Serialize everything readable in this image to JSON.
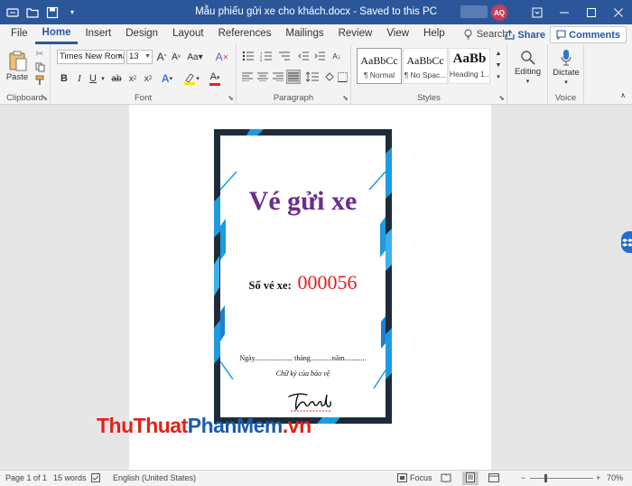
{
  "titlebar": {
    "title": "Mẫu phiếu gửi xe cho khách.docx  -  Saved to this PC",
    "avatar_initials": "AQ"
  },
  "tabs": [
    "File",
    "Home",
    "Insert",
    "Design",
    "Layout",
    "References",
    "Mailings",
    "Review",
    "View",
    "Help"
  ],
  "active_tab": "Home",
  "search_label": "Search",
  "share_label": "Share",
  "comments_label": "Comments",
  "ribbon": {
    "clipboard": {
      "label": "Clipboard",
      "paste": "Paste"
    },
    "font": {
      "label": "Font",
      "font_name": "Times New Roman",
      "font_size": "13"
    },
    "paragraph": {
      "label": "Paragraph"
    },
    "styles": {
      "label": "Styles",
      "items": [
        {
          "preview": "AaBbCc",
          "name": "¶ Normal"
        },
        {
          "preview": "AaBbCc",
          "name": "¶ No Spac..."
        },
        {
          "preview": "AaBb",
          "name": "Heading 1..."
        }
      ]
    },
    "editing": {
      "label": "Editing"
    },
    "voice": {
      "label": "Voice",
      "dictate": "Dictate"
    }
  },
  "document": {
    "card_title": "Vé gửi xe",
    "ticket_label": "Số vé xe:",
    "ticket_number": "000056",
    "date_line": "Ngày..................... tháng............năm............",
    "sign_line": "Chữ ký của bảo vệ",
    "signature": "Thành"
  },
  "watermark": {
    "part1": "ThuThuat",
    "part2": "PhanMem",
    "part3": ".vn"
  },
  "statusbar": {
    "page": "Page 1 of 1",
    "words": "15 words",
    "language": "English (United States)",
    "focus": "Focus",
    "zoom": "70%"
  },
  "colors": {
    "title_bar": "#2b579a",
    "card_border": "#1d2b3a",
    "card_title": "#6b2d8f",
    "ticket_number": "#e02020"
  }
}
